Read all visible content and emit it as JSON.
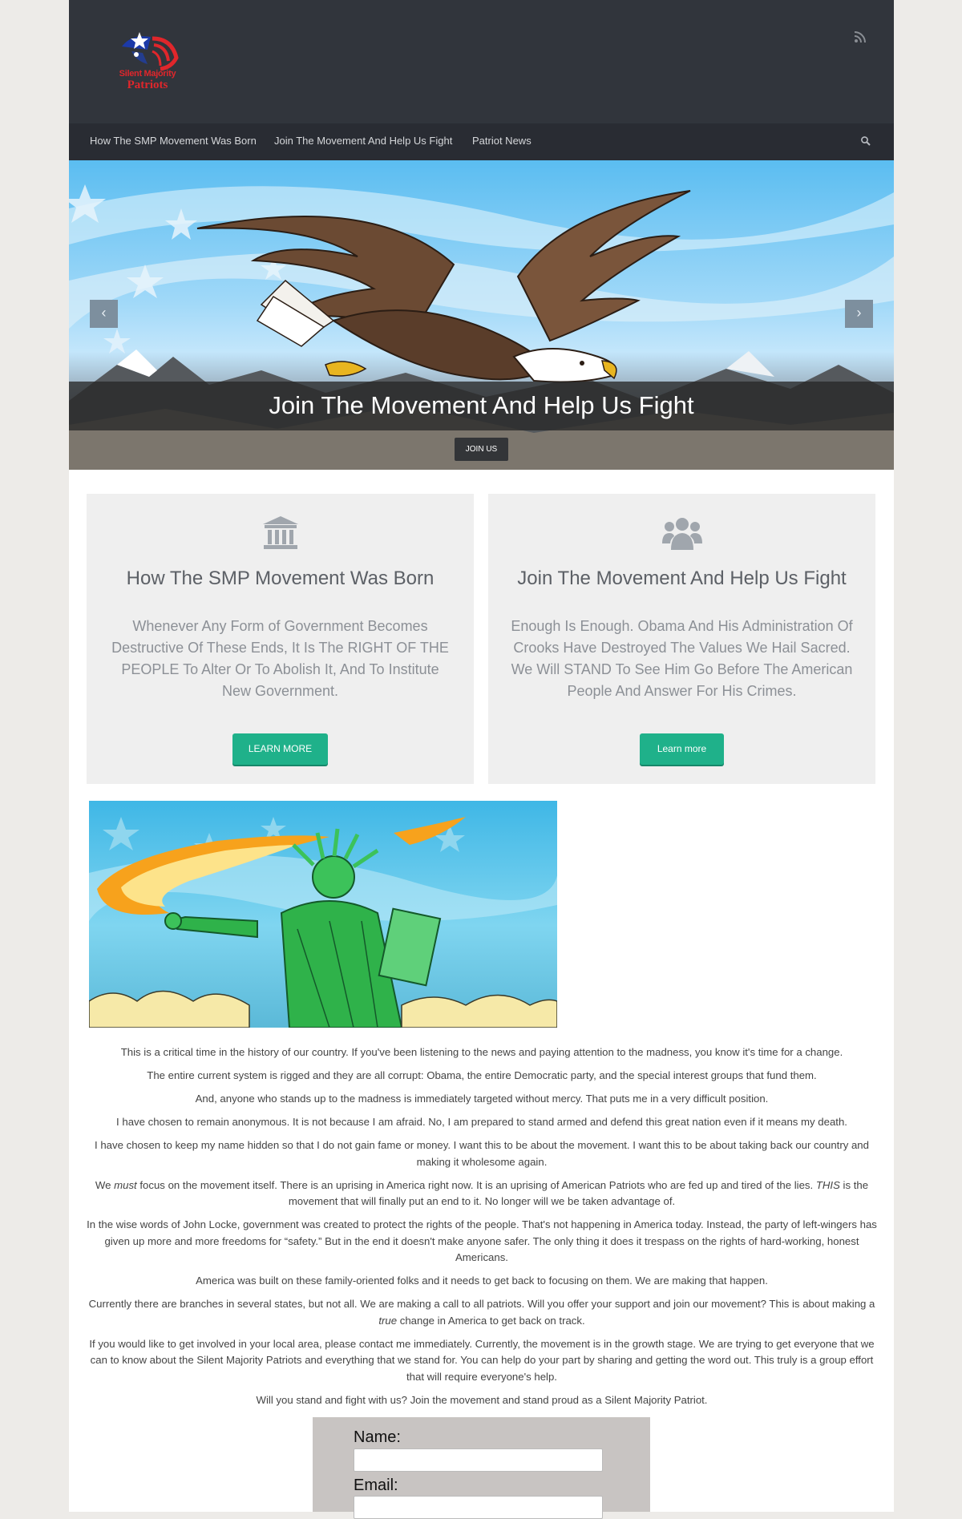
{
  "header": {
    "logo_line1": "Silent Majority",
    "logo_line2": "Patriots",
    "rss_icon": "rss-icon"
  },
  "nav": {
    "items": [
      {
        "label": "How The SMP Movement Was Born"
      },
      {
        "label": "Join The Movement And Help Us Fight"
      },
      {
        "label": "Patriot News"
      }
    ],
    "search_icon": "search-icon"
  },
  "slider": {
    "caption": "Join The Movement And Help Us Fight",
    "button_label": "JOIN US",
    "prev_label": "‹",
    "next_label": "›"
  },
  "features": [
    {
      "icon": "bank-icon",
      "title": "How The SMP Movement Was Born",
      "text": "Whenever Any Form of Government Becomes Destructive Of These Ends, It Is The RIGHT OF THE PEOPLE To Alter Or To Abolish It, And To Institute New Government.",
      "button": "LEARN MORE"
    },
    {
      "icon": "group-icon",
      "title": "Join The Movement And Help Us Fight",
      "text": "Enough Is Enough. Obama And His Administration Of Crooks Have Destroyed The Values We Hail Sacred. We Will STAND To See Him Go Before The American People And Answer For His Crimes.",
      "button": "Learn more"
    }
  ],
  "article": {
    "p1": "This is a critical time in the history of our country. If you've been listening to the news and paying attention to the madness, you know it's time for a change.",
    "p2": "The entire current system is rigged and they are all corrupt: Obama, the entire Democratic party, and the special interest groups that fund them.",
    "p3": "And, anyone who stands up to the madness is immediately targeted without mercy. That puts me in a very difficult position.",
    "p4": "I have chosen to remain anonymous. It is not because I am afraid. No, I am prepared to stand armed and defend this great nation even if it means my death.",
    "p5": "I have chosen to keep my name hidden so that I do not gain fame or money. I want this to be about the movement. I want this to be about taking back our country and making it wholesome again.",
    "p6_a": "We ",
    "p6_em1": "must",
    "p6_b": " focus on the movement itself. There is an uprising in America right now. It is an uprising of American Patriots who are fed up and tired of the lies. ",
    "p6_em2": "THIS",
    "p6_c": " is the movement that will finally put an end to it. No longer will we be taken advantage of.",
    "p7": "In the wise words of John Locke, government was created to protect the rights of the people. That's not happening in America today. Instead, the party of left-wingers has given up more and more freedoms for “safety.” But in the end it doesn't make anyone safer. The only thing it does it trespass on the rights of hard-working, honest Americans.",
    "p8": "America was built on these family-oriented folks and it needs to get back to focusing on them. We are making that happen.",
    "p9_a": "Currently there are branches in several states, but not all. We are making a call to all patriots. Will you offer your support and join our movement? This is about making a ",
    "p9_em": "true",
    "p9_b": " change in America to get back on track.",
    "p10": "If you would like to get involved in your local area, please contact me immediately. Currently, the movement is in the growth stage. We are trying to get everyone that we can to know about the Silent Majority Patriots and everything that we stand for. You can help do your part by sharing and getting the word out. This truly is a group effort that will require everyone's help.",
    "p11": "Will you stand and fight with us? Join the movement and stand proud as a Silent Majority Patriot."
  },
  "form": {
    "name_label": "Name:",
    "email_label": "Email:",
    "name_value": "",
    "email_value": ""
  },
  "colors": {
    "header_bg": "#31353c",
    "nav_bg": "#292c33",
    "accent_button": "#1fb18a",
    "page_bg": "#edebe8"
  }
}
